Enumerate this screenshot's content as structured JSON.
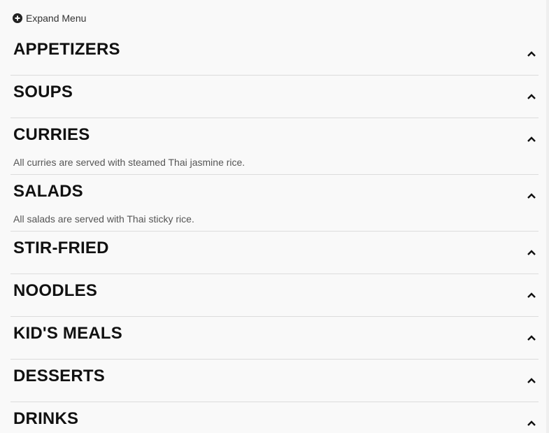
{
  "expand": {
    "label": "Expand Menu",
    "icon": "plus-circle-icon"
  },
  "sections": [
    {
      "title": "APPETIZERS",
      "description": ""
    },
    {
      "title": "SOUPS",
      "description": ""
    },
    {
      "title": "CURRIES",
      "description": "All curries are served with steamed Thai jasmine rice."
    },
    {
      "title": "SALADS",
      "description": "All salads are served with Thai sticky rice."
    },
    {
      "title": "STIR-FRIED",
      "description": ""
    },
    {
      "title": "NOODLES",
      "description": ""
    },
    {
      "title": "KID'S MEALS",
      "description": ""
    },
    {
      "title": "DESSERTS",
      "description": ""
    },
    {
      "title": "DRINKS",
      "description": ""
    }
  ],
  "colors": {
    "background": "#f9f9f9",
    "divider": "#dcdcdc",
    "text": "#111111"
  }
}
